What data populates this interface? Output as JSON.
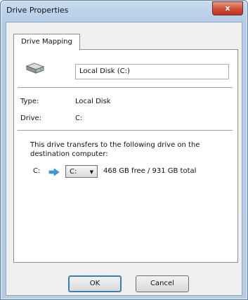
{
  "window": {
    "title": "Drive Properties",
    "close_glyph": "x"
  },
  "tabs": [
    {
      "label": "Drive Mapping"
    }
  ],
  "drive": {
    "name_value": "Local Disk (C:)",
    "type_label": "Type:",
    "type_value": "Local Disk",
    "drive_label": "Drive:",
    "drive_value": "C:"
  },
  "mapping": {
    "description": "This drive transfers to the following drive on the destination computer:",
    "source_drive": "C:",
    "selected_target": "C:",
    "space_info": "468 GB free / 931 GB total"
  },
  "buttons": {
    "ok": "OK",
    "cancel": "Cancel"
  },
  "icons": {
    "disk": "hard-disk-icon",
    "arrow": "right-arrow-icon",
    "dropdown": "chevron-down-icon"
  },
  "colors": {
    "accent": "#3c7fb1",
    "close": "#c7402a"
  }
}
